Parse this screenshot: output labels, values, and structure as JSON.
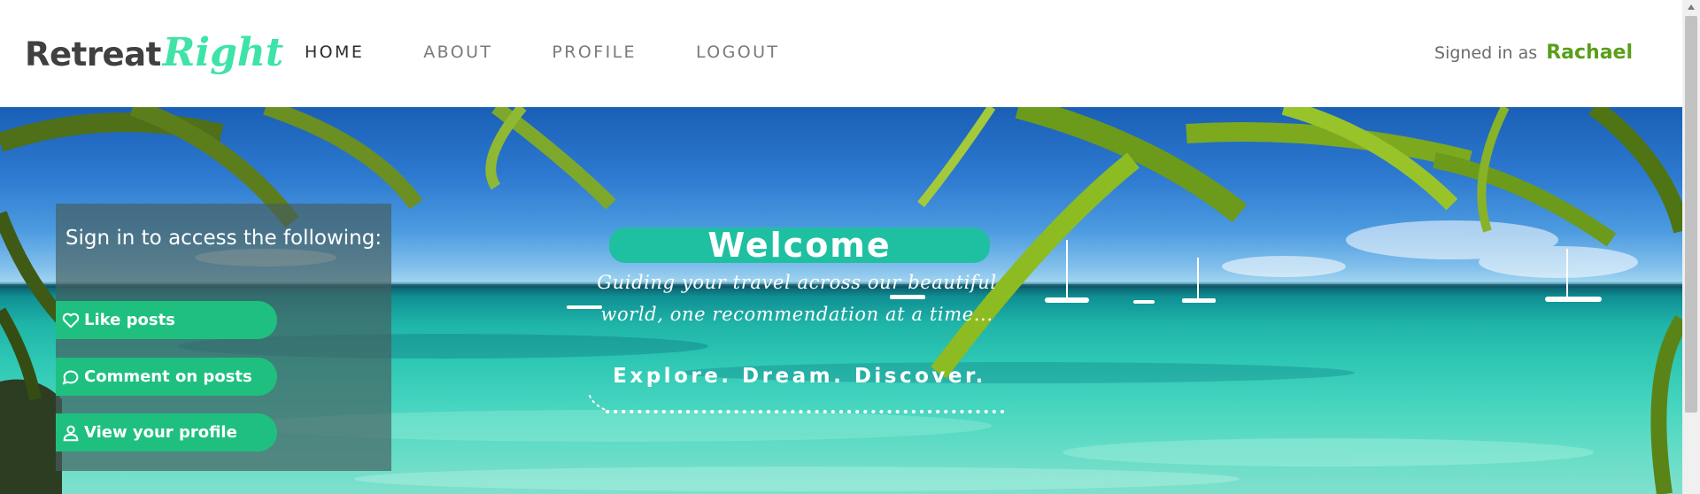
{
  "brand": {
    "part1": "Retreat",
    "part2": "Right"
  },
  "nav": {
    "items": [
      {
        "label": "HOME",
        "active": true
      },
      {
        "label": "ABOUT",
        "active": false
      },
      {
        "label": "PROFILE",
        "active": false
      },
      {
        "label": "LOGOUT",
        "active": false
      }
    ]
  },
  "account": {
    "signed_in_prefix": "Signed in as",
    "username": "Rachael"
  },
  "signin_panel": {
    "title": "Sign in to access the following:",
    "perks": [
      {
        "label": "Like posts",
        "icon": "heart-icon"
      },
      {
        "label": "Comment on posts",
        "icon": "speech-bubble-icon"
      },
      {
        "label": "View your profile",
        "icon": "user-icon"
      }
    ]
  },
  "hero": {
    "title": "Welcome",
    "subtitle_line1": "Guiding your travel across our beautiful",
    "subtitle_line2": "world, one recommendation at a time...",
    "tagline": "Explore. Dream. Discover."
  },
  "colors": {
    "brand_accent": "#3fe3a8",
    "username": "#5a9e1a",
    "perk_button": "#1fc07f",
    "welcome_pill": "#1fc0a2"
  }
}
